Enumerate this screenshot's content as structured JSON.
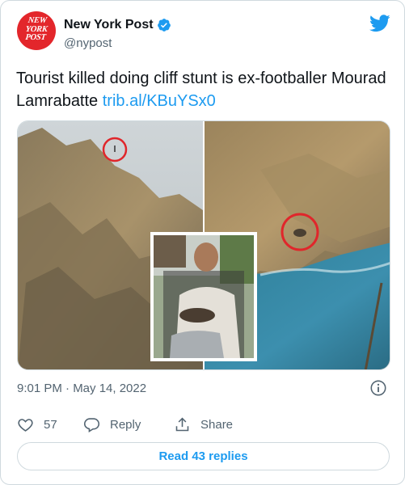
{
  "author": {
    "name": "New York Post",
    "handle": "@nypost",
    "avatar_text": [
      "NEW",
      "YORK",
      "POST"
    ],
    "avatar_color": "#e3262b"
  },
  "tweet": {
    "text": "Tourist killed doing cliff stunt is ex-footballer Mourad Lamrabatte ",
    "link": "trib.al/KBuYSx0",
    "timestamp": "9:01 PM · May 14, 2022"
  },
  "media": {
    "description": "photo-collage-cliffs-and-portrait"
  },
  "actions": {
    "likes": "57",
    "reply_label": "Reply",
    "share_label": "Share"
  },
  "read_replies_label": "Read 43 replies",
  "icons": {
    "verified": "verified-badge-icon",
    "brand": "twitter-bird-icon",
    "info": "info-icon",
    "like": "heart-icon",
    "reply": "comment-bubble-icon",
    "share": "share-upload-icon"
  },
  "colors": {
    "accent": "#1d9bf0",
    "text": "#0f1419",
    "muted": "#536471",
    "border": "#cfd9de",
    "highlight_circle": "#e0262b"
  }
}
